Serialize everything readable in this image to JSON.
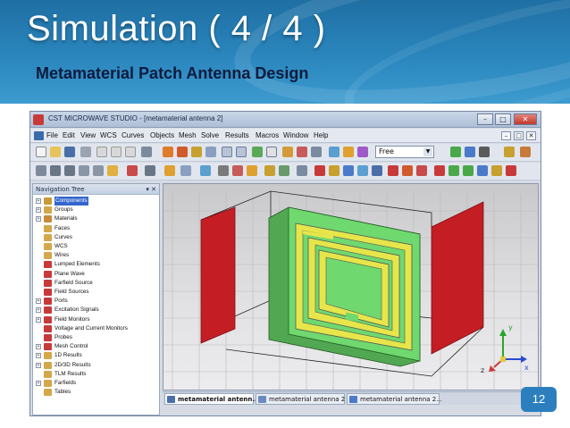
{
  "slide": {
    "title": "Simulation ( 4 / 4 )",
    "subtitle": "Metamaterial Patch Antenna Design",
    "page_number": "12"
  },
  "window": {
    "title": "CST MICROWAVE STUDIO - [metamaterial antenna 2]",
    "controls": {
      "minimize": "–",
      "maximize": "□",
      "close": "✕"
    }
  },
  "menu": {
    "items": [
      "File",
      "Edit",
      "View",
      "WCS",
      "Curves",
      "Objects",
      "Mesh",
      "Solve",
      "Results",
      "Macros",
      "Window",
      "Help"
    ],
    "mdi_controls": [
      "–",
      "□",
      "✕"
    ]
  },
  "toolbar": {
    "mode_value": "Free",
    "mode_arrow": "▼"
  },
  "navigation_tree": {
    "header": "Navigation Tree",
    "header_controls": "▾ ✕",
    "items": [
      {
        "label": "Components",
        "expandable": true,
        "selected": true
      },
      {
        "label": "Groups",
        "expandable": true
      },
      {
        "label": "Materials",
        "expandable": true
      },
      {
        "label": "Faces",
        "expandable": false
      },
      {
        "label": "Curves",
        "expandable": false
      },
      {
        "label": "WCS",
        "expandable": false
      },
      {
        "label": "Wires",
        "expandable": false
      },
      {
        "label": "Lumped Elements",
        "expandable": false
      },
      {
        "label": "Plane Wave",
        "expandable": false
      },
      {
        "label": "Farfield Source",
        "expandable": false
      },
      {
        "label": "Field Sources",
        "expandable": false
      },
      {
        "label": "Ports",
        "expandable": true
      },
      {
        "label": "Excitation Signals",
        "expandable": true
      },
      {
        "label": "Field Monitors",
        "expandable": true
      },
      {
        "label": "Voltage and Current Monitors",
        "expandable": false
      },
      {
        "label": "Probes",
        "expandable": false
      },
      {
        "label": "Mesh Control",
        "expandable": true
      },
      {
        "label": "1D Results",
        "expandable": true
      },
      {
        "label": "2D/3D Results",
        "expandable": true
      },
      {
        "label": "TLM Results",
        "expandable": false
      },
      {
        "label": "Farfields",
        "expandable": true
      },
      {
        "label": "Tables",
        "expandable": false
      }
    ]
  },
  "viewport": {
    "axes": {
      "y": "y",
      "x": "x",
      "z": "z"
    },
    "colors": {
      "port": "#c41e24",
      "substrate": "#6fd86f",
      "copper": "#e6e64a",
      "background_top": "#c9c9cc"
    }
  },
  "document_tabs": [
    {
      "label": "metamaterial antenn...",
      "active": true
    },
    {
      "label": "metamaterial antenna 2",
      "active": false
    },
    {
      "label": "metamaterial antenna 2...",
      "active": false
    }
  ]
}
